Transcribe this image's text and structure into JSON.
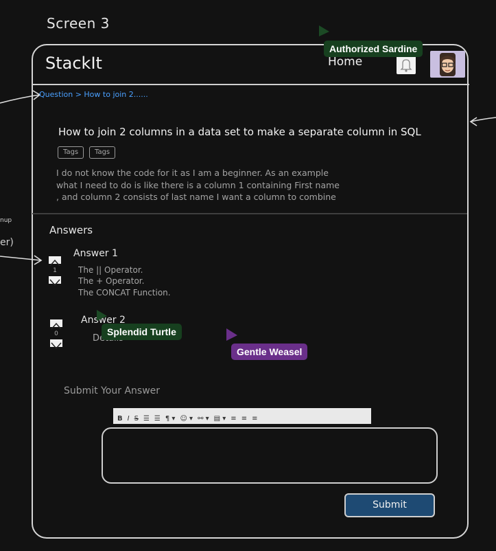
{
  "screen_label": "Screen 3",
  "header": {
    "logo": "StackIt",
    "home_link": "Home",
    "icons": [
      "bell-icon",
      "avatar"
    ]
  },
  "breadcrumb": "Question > How to join 2......",
  "question": {
    "title": "How to join 2 columns in a data set to make a separate column in SQL",
    "tags": [
      "Tags",
      "Tags"
    ],
    "description_lines": [
      "I do not know the code for it as I am a beginner. As an example",
      "what I need to do is like there is a column 1 containing First name",
      ", and column 2 consists of last name I want a column to combine"
    ]
  },
  "answers": {
    "title": "Answers",
    "items": [
      {
        "title": "Answer 1",
        "votes": "1",
        "lines": [
          "The || Operator.",
          "The + Operator.",
          "The CONCAT Function."
        ]
      },
      {
        "title": "Answer 2",
        "votes": "0",
        "lines": [
          "Details"
        ]
      }
    ]
  },
  "submit_section": {
    "title": "Submit Your Answer",
    "toolbar": [
      "B",
      "I",
      "S",
      "☰",
      "☰",
      "¶ ▾",
      "☺ ▾",
      "⚯ ▾",
      "▤ ▾",
      "≡",
      "≡",
      "≡"
    ],
    "submit_label": "Submit"
  },
  "side_annotations": [
    "nup",
    "er)"
  ],
  "cursors": [
    {
      "name": "Authorized Sardine",
      "color": "#17401f"
    },
    {
      "name": "Splendid Turtle",
      "color": "#17401f"
    },
    {
      "name": "Gentle Weasel",
      "color": "#6a2f8a"
    }
  ]
}
